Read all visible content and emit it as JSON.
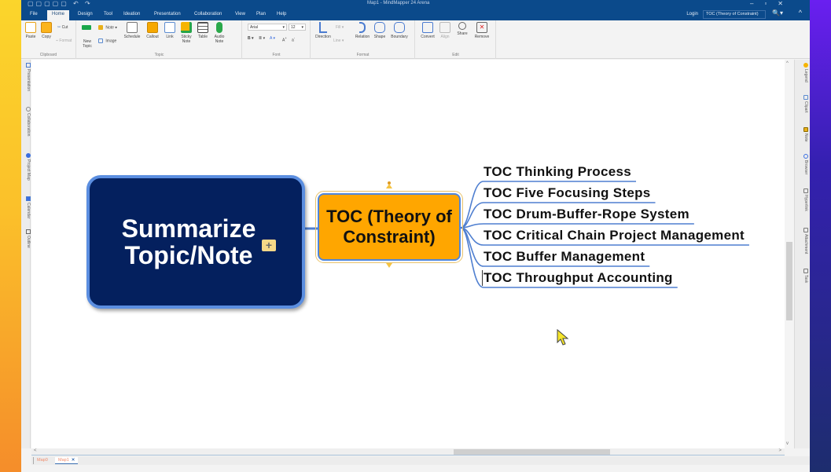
{
  "window": {
    "title": "Map1 - MindMapper 24 Arena",
    "controls": [
      "minimize",
      "restore",
      "close"
    ]
  },
  "menu_tabs": [
    {
      "label": "File"
    },
    {
      "label": "Home",
      "active": true
    },
    {
      "label": "Design"
    },
    {
      "label": "Tool"
    },
    {
      "label": "Ideation"
    },
    {
      "label": "Presentation"
    },
    {
      "label": "Collaboration"
    },
    {
      "label": "View"
    },
    {
      "label": "Plan"
    },
    {
      "label": "Help"
    }
  ],
  "header_right": {
    "login_label": "Login",
    "search_value": "TOC (Theory of Constraint)"
  },
  "ribbon": {
    "clipboard": {
      "label": "Clipboard",
      "paste": "Paste",
      "copy": "Copy",
      "cut": "Cut",
      "format": "Format"
    },
    "topic": {
      "label": "Topic",
      "new_topic": "New Topic",
      "note": "Note",
      "image": "Image",
      "schedule": "Schedule",
      "callout": "Callout",
      "link": "Link",
      "sticky_note": "Sticky Note",
      "table": "Table",
      "audio_note": "Audio Note"
    },
    "font": {
      "label": "Font",
      "family": "Arial",
      "size": "12"
    },
    "format": {
      "label": "Format",
      "direction": "Direction",
      "fill": "Fill",
      "line": "Line",
      "relation": "Relation",
      "shape": "Shape",
      "boundary": "Boundary"
    },
    "edit": {
      "label": "Edit",
      "convert": "Convert",
      "align": "Align",
      "share": "Share",
      "remove": "Remove"
    }
  },
  "left_panel": [
    "Presentation",
    "Collaboration",
    "Project Map",
    "Calendar",
    "Outline"
  ],
  "right_panel": [
    "Legend",
    "Clipart",
    "Note",
    "Browser",
    "Hyperlink",
    "Attachment",
    "Task"
  ],
  "map": {
    "central_topic": "Summarize Topic/Note",
    "main_topic": "TOC (Theory of Constraint)",
    "subtopics": [
      "TOC Thinking Process",
      "TOC Five Focusing Steps",
      "TOC Drum-Buffer-Rope System",
      "TOC Critical Chain Project Management",
      "TOC Buffer Management",
      "TOC Throughput Accounting"
    ]
  },
  "doc_tabs": [
    {
      "label": "Map0"
    },
    {
      "label": "Map1",
      "active": true
    }
  ],
  "colors": {
    "title_bar": "#0b4a8b",
    "central_fill": "#04205e",
    "central_border": "#5b8ee0",
    "main_topic_fill": "#ffa600",
    "connector": "#4f7fd0"
  }
}
